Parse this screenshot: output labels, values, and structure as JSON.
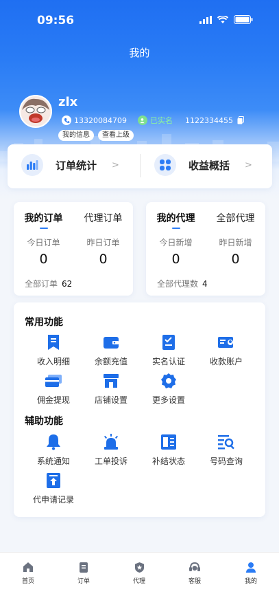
{
  "status_bar": {
    "time": "09:56"
  },
  "header": {
    "title": "我的"
  },
  "profile": {
    "name": "zlx",
    "phone": "13320084709",
    "verified_label": "已实名",
    "user_id": "1122334455",
    "my_info_label": "我的信息",
    "view_superior_label": "查看上级"
  },
  "summary": {
    "orders_label": "订单统计",
    "earnings_label": "收益概括",
    "arrow": ">"
  },
  "orders_card": {
    "tab_mine": "我的订单",
    "tab_agent": "代理订单",
    "today_label": "今日订单",
    "yesterday_label": "昨日订单",
    "today_value": "0",
    "yesterday_value": "0",
    "total_label": "全部订单",
    "total_value": "62"
  },
  "agents_card": {
    "tab_mine": "我的代理",
    "tab_all": "全部代理",
    "today_label": "今日新增",
    "yesterday_label": "昨日新增",
    "today_value": "0",
    "yesterday_value": "0",
    "total_label": "全部代理数",
    "total_value": "4"
  },
  "common_functions": {
    "title": "常用功能",
    "items": [
      {
        "label": "收入明细",
        "icon": "bookmark-icon"
      },
      {
        "label": "余额充值",
        "icon": "wallet-icon"
      },
      {
        "label": "实名认证",
        "icon": "checklist-icon"
      },
      {
        "label": "收款账户",
        "icon": "id-card-icon"
      },
      {
        "label": "佣金提现",
        "icon": "card-icon"
      },
      {
        "label": "店铺设置",
        "icon": "store-icon"
      },
      {
        "label": "更多设置",
        "icon": "gear-icon"
      }
    ]
  },
  "aux_functions": {
    "title": "辅助功能",
    "items": [
      {
        "label": "系统通知",
        "icon": "bell-icon"
      },
      {
        "label": "工单投诉",
        "icon": "alarm-icon"
      },
      {
        "label": "补结状态",
        "icon": "ledger-icon"
      },
      {
        "label": "号码查询",
        "icon": "list-search-icon"
      },
      {
        "label": "代申请记录",
        "icon": "upload-icon"
      }
    ]
  },
  "tabbar": {
    "items": [
      {
        "label": "首页",
        "icon": "home-icon"
      },
      {
        "label": "订单",
        "icon": "order-icon"
      },
      {
        "label": "代理",
        "icon": "agent-icon"
      },
      {
        "label": "客服",
        "icon": "service-icon"
      },
      {
        "label": "我的",
        "icon": "user-icon"
      }
    ],
    "active_index": 4
  },
  "colors": {
    "primary": "#2b7cf5",
    "icon_blue": "#1e6ee8",
    "verified_green": "#8ef59c"
  }
}
